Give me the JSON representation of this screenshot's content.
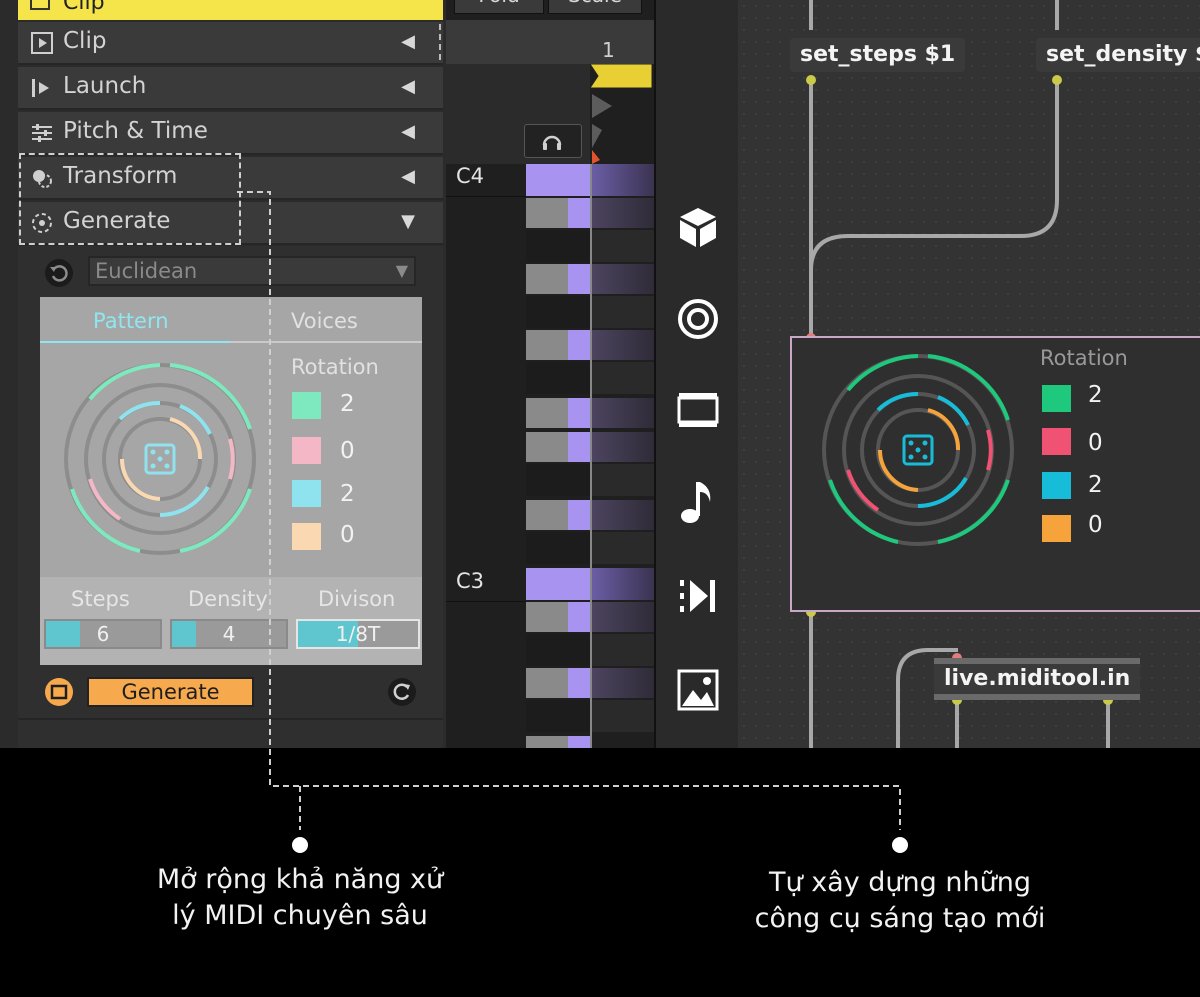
{
  "left_panel": {
    "clip_header": "Clip",
    "sections": [
      {
        "label": "Clip",
        "icon": "play-frame-icon"
      },
      {
        "label": "Launch",
        "icon": "launch-icon"
      },
      {
        "label": "Pitch & Time",
        "icon": "sliders-icon"
      },
      {
        "label": "Transform",
        "icon": "transform-icon"
      },
      {
        "label": "Generate",
        "icon": "generate-icon"
      }
    ],
    "generator": {
      "type_value": "Euclidean",
      "tabs": [
        "Pattern",
        "Voices"
      ],
      "rotation_label": "Rotation",
      "rotation": [
        {
          "value": "2",
          "color": "#7ee8bf"
        },
        {
          "value": "0",
          "color": "#f4b7c6"
        },
        {
          "value": "2",
          "color": "#8ee3ee"
        },
        {
          "value": "0",
          "color": "#f9d8b2"
        }
      ],
      "fields": [
        {
          "label": "Steps",
          "value": "6"
        },
        {
          "label": "Density",
          "value": "4"
        },
        {
          "label": "Divison",
          "value": "1/8T"
        }
      ],
      "generate_label": "Generate"
    }
  },
  "piano": {
    "top_buttons": [
      "Fold",
      "Scale"
    ],
    "bar_number": "1",
    "key_labels": [
      "C4",
      "C3"
    ]
  },
  "icon_strip": [
    "cube-icon",
    "target-icon",
    "clip-view-icon",
    "note-icon",
    "skip-icon",
    "image-icon"
  ],
  "patcher": {
    "objects": [
      "set_steps $1",
      "set_density $",
      "live.miditool.in"
    ],
    "rotation_label": "Rotation",
    "rotation": [
      {
        "value": "2",
        "color": "#1ec97e"
      },
      {
        "value": "0",
        "color": "#f05274"
      },
      {
        "value": "2",
        "color": "#17bcd8"
      },
      {
        "value": "0",
        "color": "#f6a33c"
      }
    ]
  },
  "captions": {
    "left": [
      "Mở rộng khả năng xử",
      "lý MIDI chuyên sâu"
    ],
    "right": [
      "Tự xây dựng những",
      "công cụ sáng tạo mới"
    ]
  }
}
